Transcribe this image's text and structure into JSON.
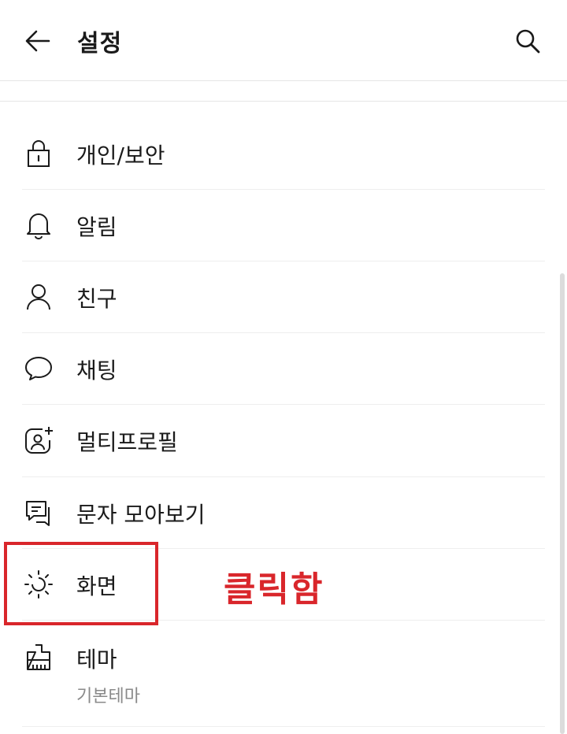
{
  "header": {
    "title": "설정"
  },
  "menu": {
    "items": [
      {
        "label": "개인/보안",
        "icon": "lock-icon"
      },
      {
        "label": "알림",
        "icon": "bell-icon"
      },
      {
        "label": "친구",
        "icon": "person-icon"
      },
      {
        "label": "채팅",
        "icon": "chat-bubble-icon"
      },
      {
        "label": "멀티프로필",
        "icon": "multi-profile-icon"
      },
      {
        "label": "문자 모아보기",
        "icon": "message-collect-icon"
      },
      {
        "label": "화면",
        "icon": "display-brightness-icon"
      },
      {
        "label": "테마",
        "sublabel": "기본테마",
        "icon": "paintbrush-icon"
      }
    ]
  },
  "annotation": {
    "text": "클릭함",
    "color": "#d9262b"
  },
  "colors": {
    "text": "#1a1a1a",
    "subtext": "#8a8a8a",
    "divider": "#eeeeee",
    "accent": "#d9262b"
  }
}
